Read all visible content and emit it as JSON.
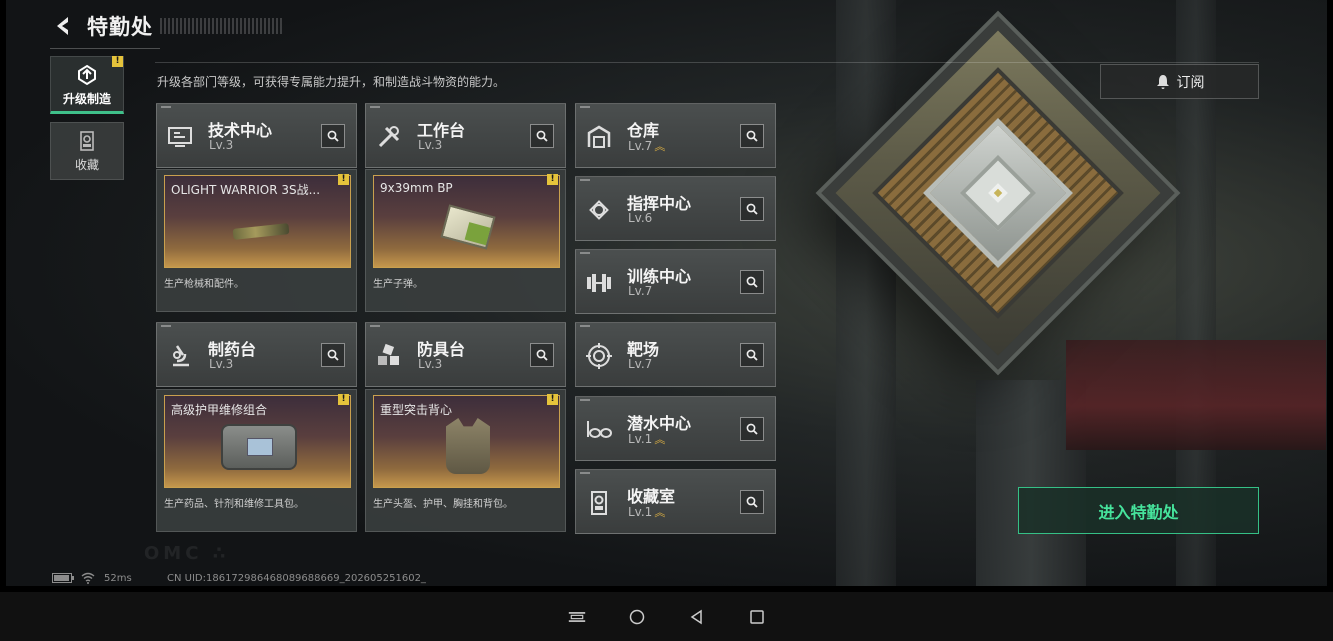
{
  "header": {
    "title": "特勤处"
  },
  "side_tabs": [
    {
      "label": "升级制造",
      "active": true,
      "badge": "!"
    },
    {
      "label": "收藏",
      "active": false
    }
  ],
  "subtitle": "升级各部门等级，可获得专属能力提升，和制造战斗物资的能力。",
  "subscribe_label": "订阅",
  "departments": [
    {
      "name": "技术中心",
      "level": "Lv.3",
      "icon": "monitor-icon"
    },
    {
      "name": "工作台",
      "level": "Lv.3",
      "icon": "tools-icon"
    },
    {
      "name": "仓库",
      "level": "Lv.7",
      "icon": "warehouse-icon",
      "upgrade": "^"
    },
    {
      "name": "指挥中心",
      "level": "Lv.6",
      "icon": "chip-icon"
    },
    {
      "name": "训练中心",
      "level": "Lv.7",
      "icon": "dumbbell-icon"
    },
    {
      "name": "制药台",
      "level": "Lv.3",
      "icon": "microscope-icon"
    },
    {
      "name": "防具台",
      "level": "Lv.3",
      "icon": "cubes-icon"
    },
    {
      "name": "靶场",
      "level": "Lv.7",
      "icon": "target-icon"
    },
    {
      "name": "潜水中心",
      "level": "Lv.1",
      "icon": "goggles-icon",
      "upgrade": "^"
    },
    {
      "name": "收藏室",
      "level": "Lv.1",
      "icon": "collection-icon",
      "upgrade": "^"
    }
  ],
  "products": [
    {
      "name": "OLIGHT WARRIOR 3S战...",
      "desc": "生产枪械和配件。",
      "badge": "!",
      "icon": "flashlight-icon"
    },
    {
      "name": "9x39mm BP",
      "desc": "生产子弹。",
      "badge": "!",
      "icon": "ammo-box-icon"
    },
    {
      "name": "高级护甲维修组合",
      "desc": "生产药品、针剂和维修工具包。",
      "badge": "!",
      "icon": "repair-bag-icon"
    },
    {
      "name": "重型突击背心",
      "desc": "生产头盔、护甲、胸挂和背包。",
      "badge": "!",
      "icon": "vest-icon"
    }
  ],
  "enter_label": "进入特勤处",
  "status": {
    "ping": "52ms",
    "uid": "CN UID:1861729864680896886​69_202605251602_"
  },
  "colors": {
    "accent_green": "#46e39c",
    "badge_yellow": "#e5c33b",
    "upgrade_gold": "#e1b343"
  }
}
